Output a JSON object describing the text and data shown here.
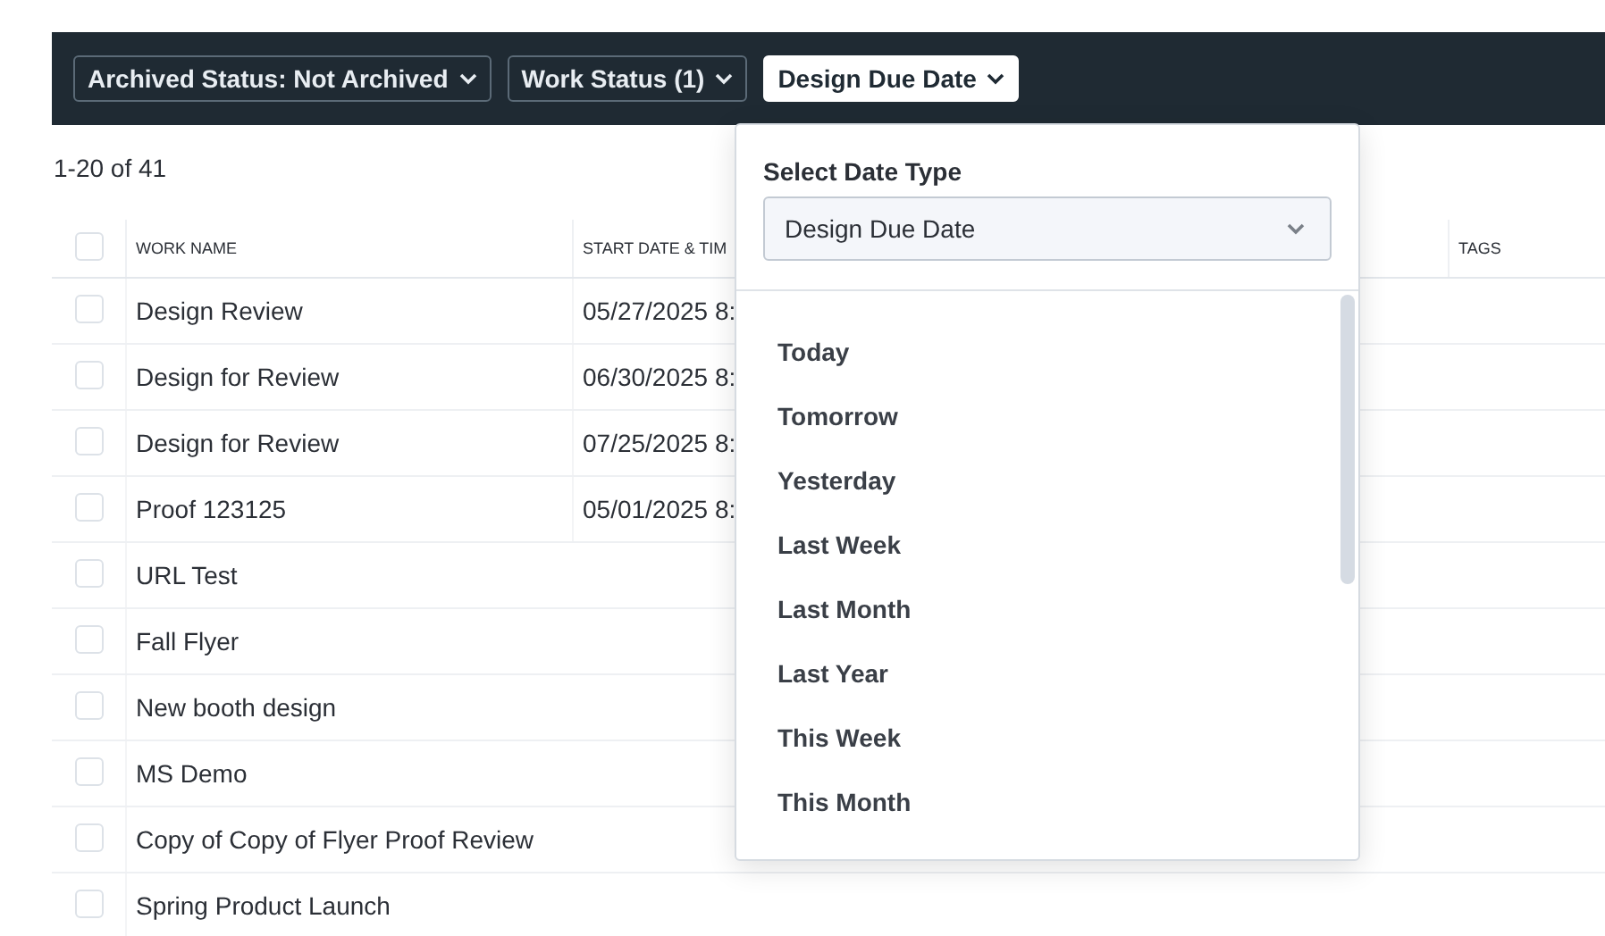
{
  "filters": [
    {
      "label": "Archived Status: Not Archived",
      "active": false
    },
    {
      "label": "Work Status (1)",
      "active": false
    },
    {
      "label": "Design Due Date",
      "active": true
    }
  ],
  "result_count": "1-20 of 41",
  "table": {
    "select_all_checked": false,
    "columns": [
      "WORK NAME",
      "START DATE & TIM",
      "",
      "",
      "",
      "TAGS"
    ],
    "rows": [
      {
        "checked": false,
        "cells": [
          "Design Review",
          "05/27/2025 8:"
        ]
      },
      {
        "checked": false,
        "cells": [
          "Design for Review",
          "06/30/2025 8:"
        ]
      },
      {
        "checked": false,
        "cells": [
          "Design for Review",
          "07/25/2025 8:"
        ]
      },
      {
        "checked": false,
        "cells": [
          "Proof 123125",
          "05/01/2025 8:"
        ]
      },
      {
        "checked": false,
        "cells": [
          "URL Test",
          ""
        ]
      },
      {
        "checked": false,
        "cells": [
          "Fall Flyer",
          ""
        ]
      },
      {
        "checked": false,
        "cells": [
          "New booth design",
          ""
        ]
      },
      {
        "checked": false,
        "cells": [
          "MS Demo",
          ""
        ]
      },
      {
        "checked": false,
        "cells": [
          "Copy of Copy of Flyer Proof Review",
          ""
        ]
      },
      {
        "checked": false,
        "cells": [
          "Spring Product Launch",
          ""
        ]
      }
    ]
  },
  "date_popover": {
    "label": "Select Date Type",
    "select_value": "Design Due Date",
    "options": [
      "Today",
      "Tomorrow",
      "Yesterday",
      "Last Week",
      "Last Month",
      "Last Year",
      "This Week",
      "This Month"
    ]
  }
}
